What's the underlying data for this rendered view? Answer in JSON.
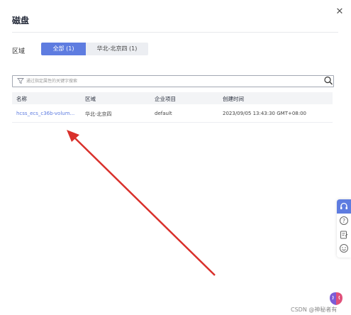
{
  "dialog": {
    "title": "磁盘"
  },
  "filter": {
    "region_label": "区域",
    "tabs": [
      {
        "label": "全部 (1)",
        "active": true
      },
      {
        "label": "华北-北京四 (1)",
        "active": false
      }
    ]
  },
  "search": {
    "placeholder": "通过指定属性的关键字搜索"
  },
  "table": {
    "headers": [
      "名称",
      "区域",
      "企业项目",
      "创建时间"
    ],
    "rows": [
      {
        "name": "hcss_ecs_c36b-volum...",
        "region": "华北-北京四",
        "project": "default",
        "created": "2023/09/05 13:43:30 GMT+08:00"
      }
    ]
  },
  "watermark": "CSDN @神秘者有",
  "colors": {
    "accent": "#5e7ce0",
    "arrow": "#d9302b"
  },
  "icons": [
    "close-icon",
    "filter-icon",
    "search-icon",
    "headset-icon",
    "help-icon",
    "feedback-icon",
    "smile-icon",
    "brain-logo-icon"
  ]
}
